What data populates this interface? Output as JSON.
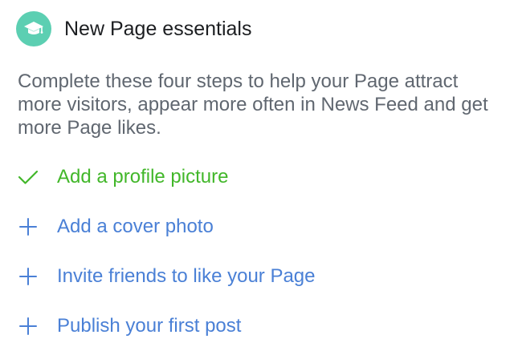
{
  "header": {
    "icon": "graduation-cap-icon",
    "title": "New Page essentials"
  },
  "description": "Complete these four steps to help your Page attract more visitors, appear more often in News Feed and get more Page likes.",
  "steps": [
    {
      "label": "Add a profile picture",
      "icon": "checkmark-icon",
      "completed": true
    },
    {
      "label": "Add a cover photo",
      "icon": "plus-icon",
      "completed": false
    },
    {
      "label": "Invite friends to like your Page",
      "icon": "plus-icon",
      "completed": false
    },
    {
      "label": "Publish your first post",
      "icon": "plus-icon",
      "completed": false
    }
  ],
  "colors": {
    "badge": "#5ccfb2",
    "completed": "#42b72a",
    "link": "#4a80d6"
  }
}
